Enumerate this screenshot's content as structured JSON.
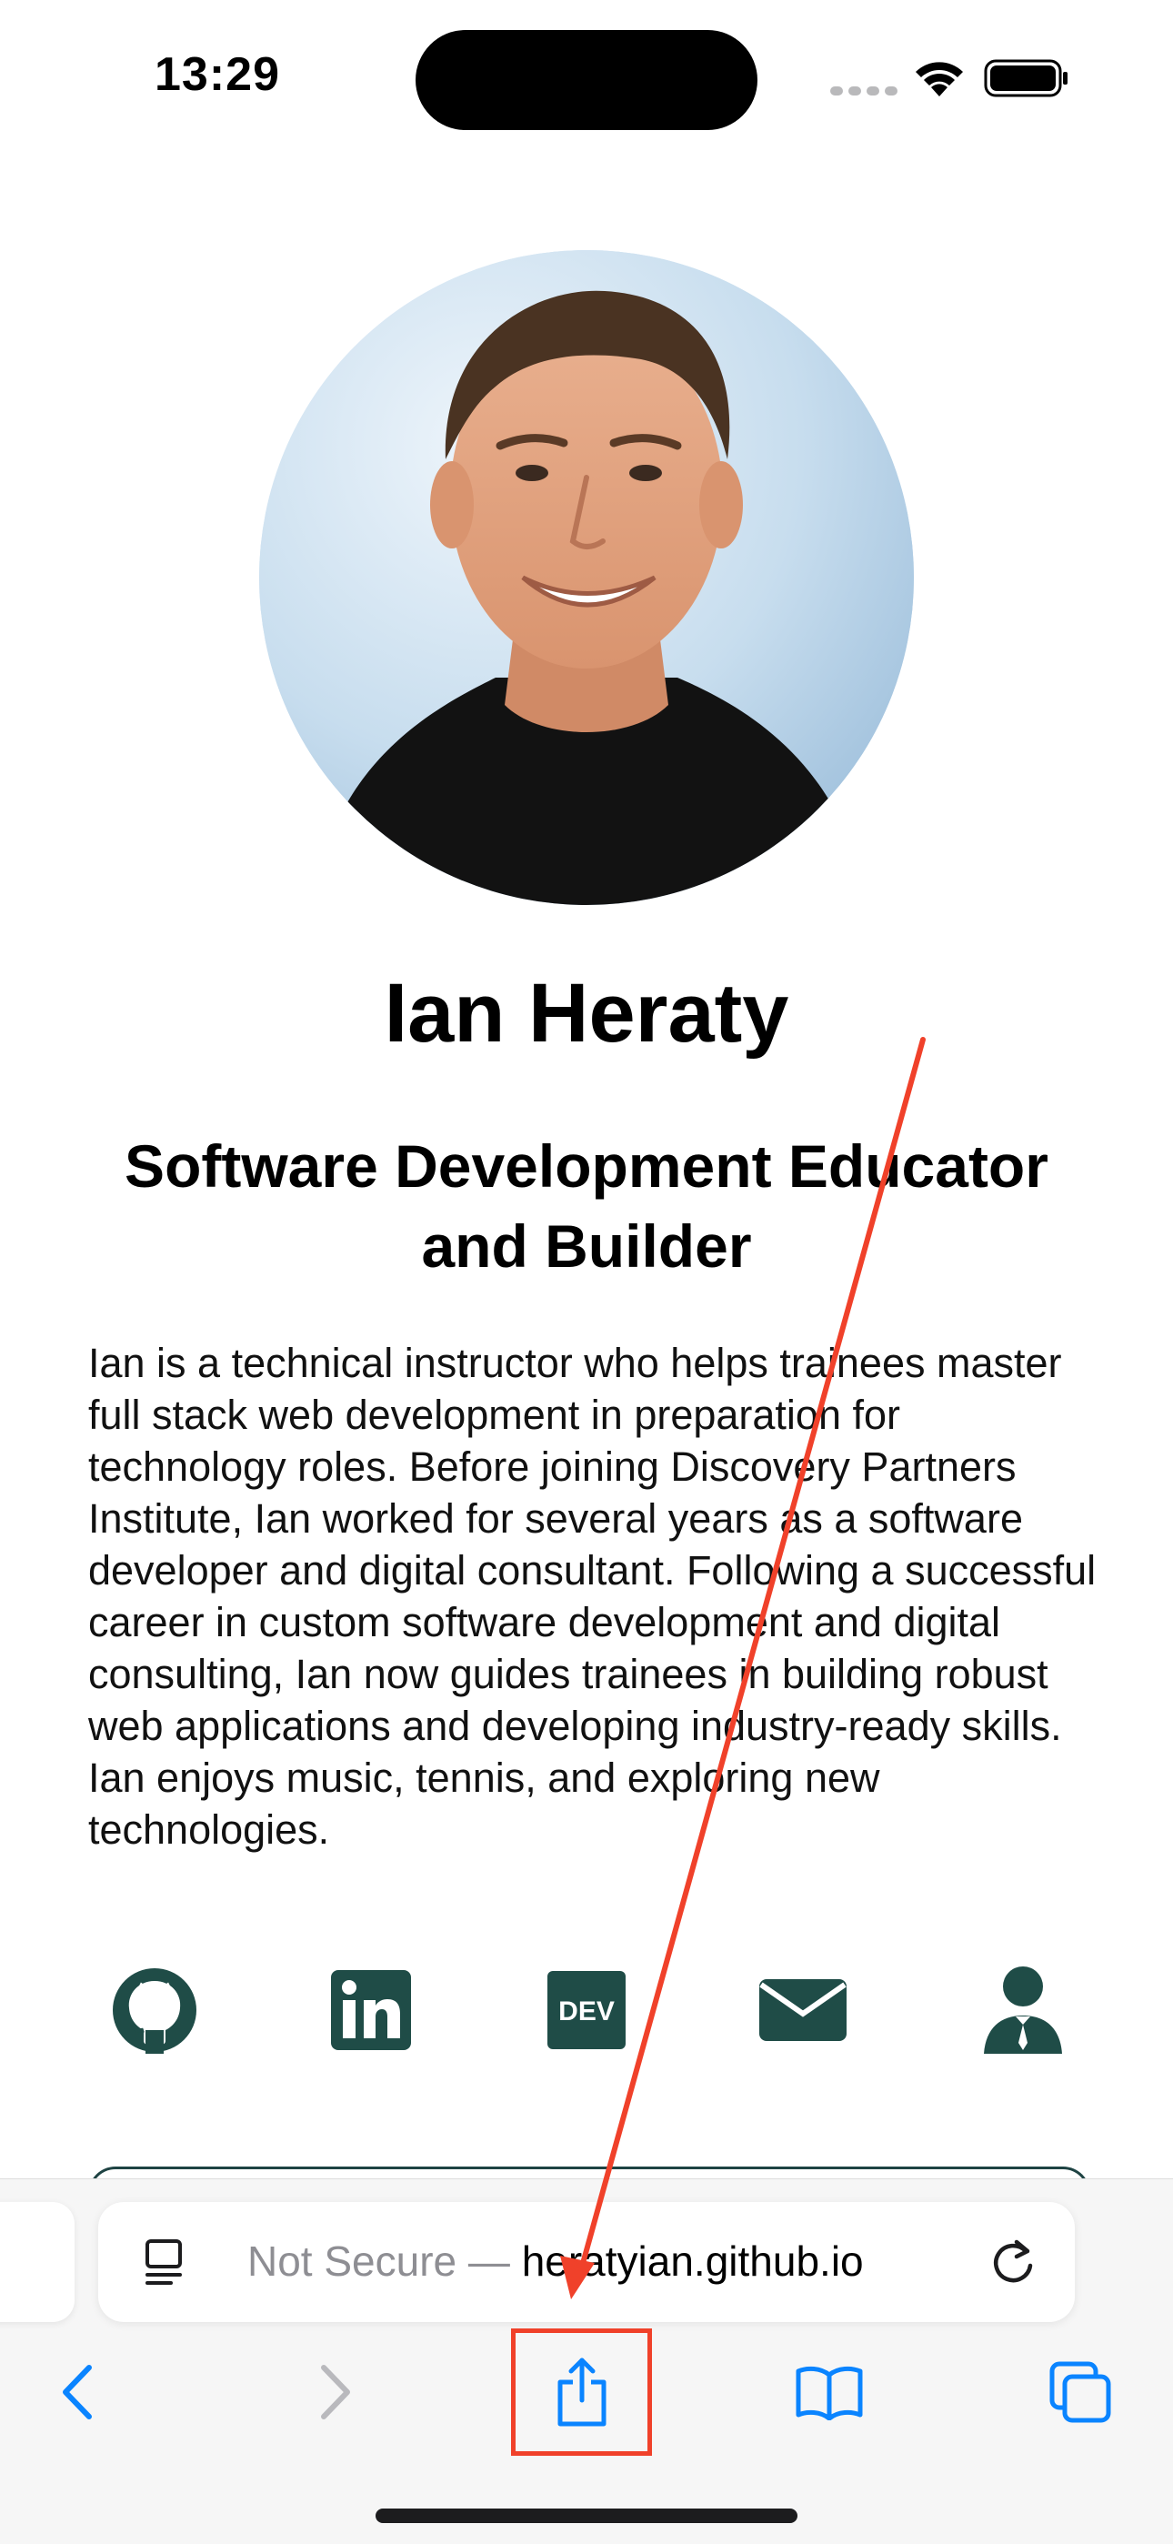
{
  "status_bar": {
    "time": "13:29"
  },
  "profile": {
    "name": "Ian Heraty",
    "subtitle": "Software Development Educator and Builder",
    "bio": "Ian is a technical instructor who helps trainees master full stack web development in preparation for technology roles. Before joining Discovery Partners Institute, Ian worked for several years as a software developer and digital consultant. Following a successful career in custom software development and digital consulting, Ian now guides trainees in building robust web applications and developing industry-ready skills. Ian enjoys music, tennis, and exploring new technologies.",
    "social_icons": [
      "github-icon",
      "linkedin-icon",
      "dev-icon",
      "email-icon",
      "resume-icon"
    ],
    "dev_badge_text": "DEV",
    "brand_color": "#1f4c47"
  },
  "browser": {
    "security_label": "Not Secure",
    "separator": " — ",
    "domain": "heratyian.github.io",
    "accent_color": "#0a84ff",
    "toolbar_icons": [
      "back-icon",
      "forward-icon",
      "share-icon",
      "bookmarks-icon",
      "tabs-icon"
    ]
  },
  "annotation": {
    "color": "#f0412a",
    "target": "share-button"
  }
}
